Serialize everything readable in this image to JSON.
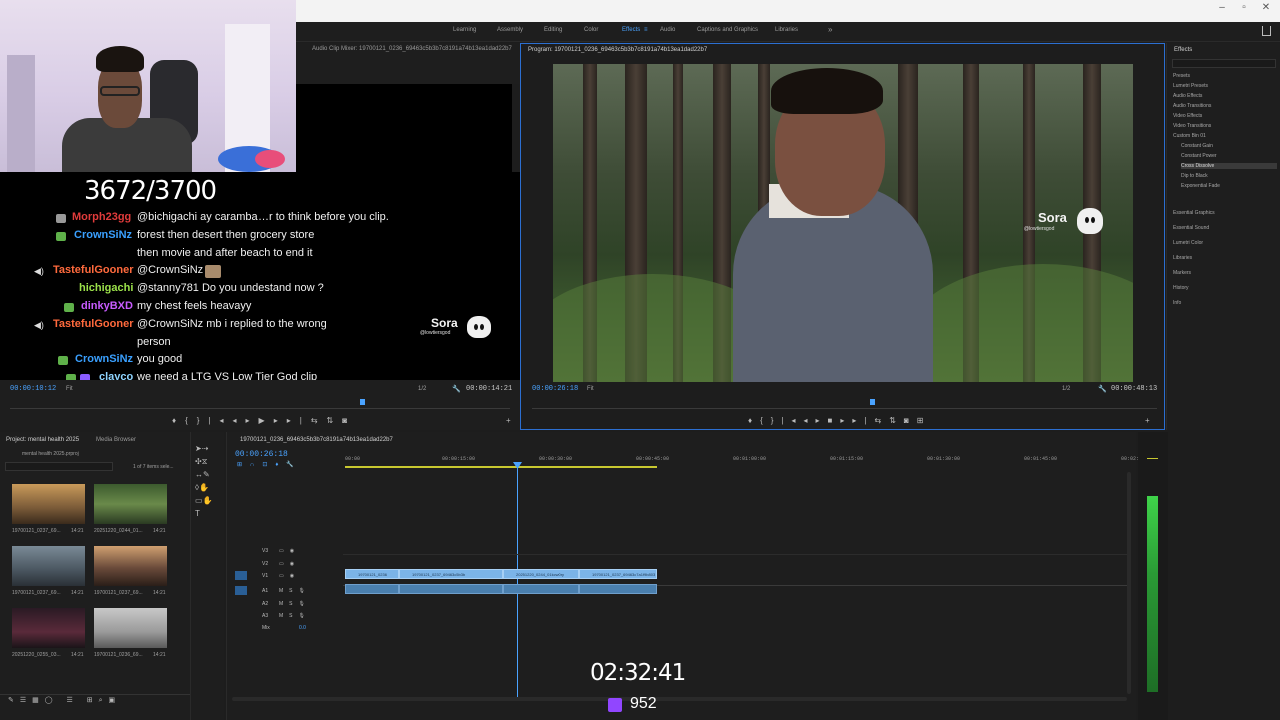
{
  "window": {
    "minimize": "–",
    "maximize": "▫",
    "close": "✕"
  },
  "workspaces": {
    "items": [
      {
        "label": "Learning",
        "active": false
      },
      {
        "label": "Assembly",
        "active": false
      },
      {
        "label": "Editing",
        "active": false
      },
      {
        "label": "Color",
        "active": false
      },
      {
        "label": "Effects",
        "active": true
      },
      {
        "label": "Audio",
        "active": false
      },
      {
        "label": "Captions and Graphics",
        "active": false
      },
      {
        "label": "Libraries",
        "active": false
      }
    ],
    "more": "»",
    "effects_menu": "≡"
  },
  "overlay": {
    "channel_points": "3672/3700",
    "stream_timer": "02:32:41",
    "viewer_count": "952"
  },
  "chat": {
    "messages": [
      {
        "user": "Morph23gg",
        "user_color": "#e03b3b",
        "text": "@bichigachi ay caramba",
        "overlap_text": "…r to think before you clip."
      },
      {
        "user": "CrownSiNz",
        "user_color": "#3aa0ff",
        "text": "forest then desert then grocery store",
        "cont": "then movie and after beach to end it"
      },
      {
        "user": "TastefulGooner",
        "user_color": "#ff6a3d",
        "text": "@CrownSiNz"
      },
      {
        "user": "hichigachi",
        "user_color": "#9be14a",
        "text": "@stanny781 Do you undestand now ?"
      },
      {
        "user": "dinkyBXD",
        "user_color": "#c85cff",
        "text": "my chest feels heavayy"
      },
      {
        "user": "TastefulGooner",
        "user_color": "#ff6a3d",
        "text": "@CrownSiNz mb i replied to the wrong",
        "cont": "person"
      },
      {
        "user": "CrownSiNz",
        "user_color": "#3aa0ff",
        "text": "you good"
      },
      {
        "user": "clayco",
        "user_color": "#8fd4ff",
        "text": "we need a LTG VS Low Tier God clip"
      }
    ]
  },
  "watermark": {
    "brand": "Sora",
    "handle": "@lowtiersgod"
  },
  "source_monitor": {
    "tab": "Audio Clip Mixer: 19700121_0236_69463c5b3b7c8191a74b13ea1dad22b7",
    "timecode": "00:00:10:12",
    "fit": "Fit",
    "zoom": "1/2",
    "duration": "00:00:14:21"
  },
  "program_monitor": {
    "tab": "Program: 19700121_0236_69463c5b3b7c8191a74b13ea1dad22b7",
    "timecode": "00:00:26:18",
    "fit": "Fit",
    "zoom": "1/2",
    "duration": "00:00:48:13"
  },
  "effects_panel": {
    "title": "Effects",
    "tree": [
      {
        "label": "Presets",
        "level": 0
      },
      {
        "label": "Lumetri Presets",
        "level": 0
      },
      {
        "label": "Audio Effects",
        "level": 0
      },
      {
        "label": "Audio Transitions",
        "level": 0
      },
      {
        "label": "Video Effects",
        "level": 0
      },
      {
        "label": "Video Transitions",
        "level": 0
      },
      {
        "label": "Custom Bin 01",
        "level": 0
      },
      {
        "label": "Constant Gain",
        "level": 1
      },
      {
        "label": "Constant Power",
        "level": 1
      },
      {
        "label": "Cross Dissolve",
        "level": 1,
        "selected": true
      },
      {
        "label": "Dip to Black",
        "level": 1
      },
      {
        "label": "Exponential Fade",
        "level": 1
      }
    ],
    "sections": [
      "Essential Graphics",
      "Essential Sound",
      "Lumetri Color",
      "Libraries",
      "Markers",
      "History",
      "Info"
    ]
  },
  "project": {
    "tab_project": "Project: mental health 2025",
    "tab_media": "Media Browser",
    "file": "mental health 2025.prproj",
    "selection": "1 of 7 items sele...",
    "items": [
      {
        "name": "19700121_0237_69...",
        "dur": "14:21"
      },
      {
        "name": "20251220_0244_01...",
        "dur": "14:21"
      },
      {
        "name": "19700121_0237_69...",
        "dur": "14:21"
      },
      {
        "name": "19700121_0237_69...",
        "dur": "14:21"
      },
      {
        "name": "20251220_0255_03...",
        "dur": "14:21"
      },
      {
        "name": "19700121_0236_69...",
        "dur": "14:21"
      }
    ]
  },
  "timeline": {
    "tab": "19700121_0236_69463c5b3b7c8191a74b13ea1dad22b7",
    "timecode": "00:00:26:18",
    "ruler": [
      "00:00",
      "00:00:15:00",
      "00:00:30:00",
      "00:00:45:00",
      "00:01:00:00",
      "00:01:15:00",
      "00:01:30:00",
      "00:01:45:00",
      "00:02:00"
    ],
    "tracks": [
      "V3",
      "V2",
      "V1",
      "A1",
      "A2",
      "A3",
      "Mix"
    ],
    "mix_value": "0.0",
    "clips": [
      "19700121_0236",
      "19700121_0237_69463c5b3b",
      "20251220_0244_01kcw0ry",
      "19700121_0237_69463c7a1f9b803"
    ]
  }
}
